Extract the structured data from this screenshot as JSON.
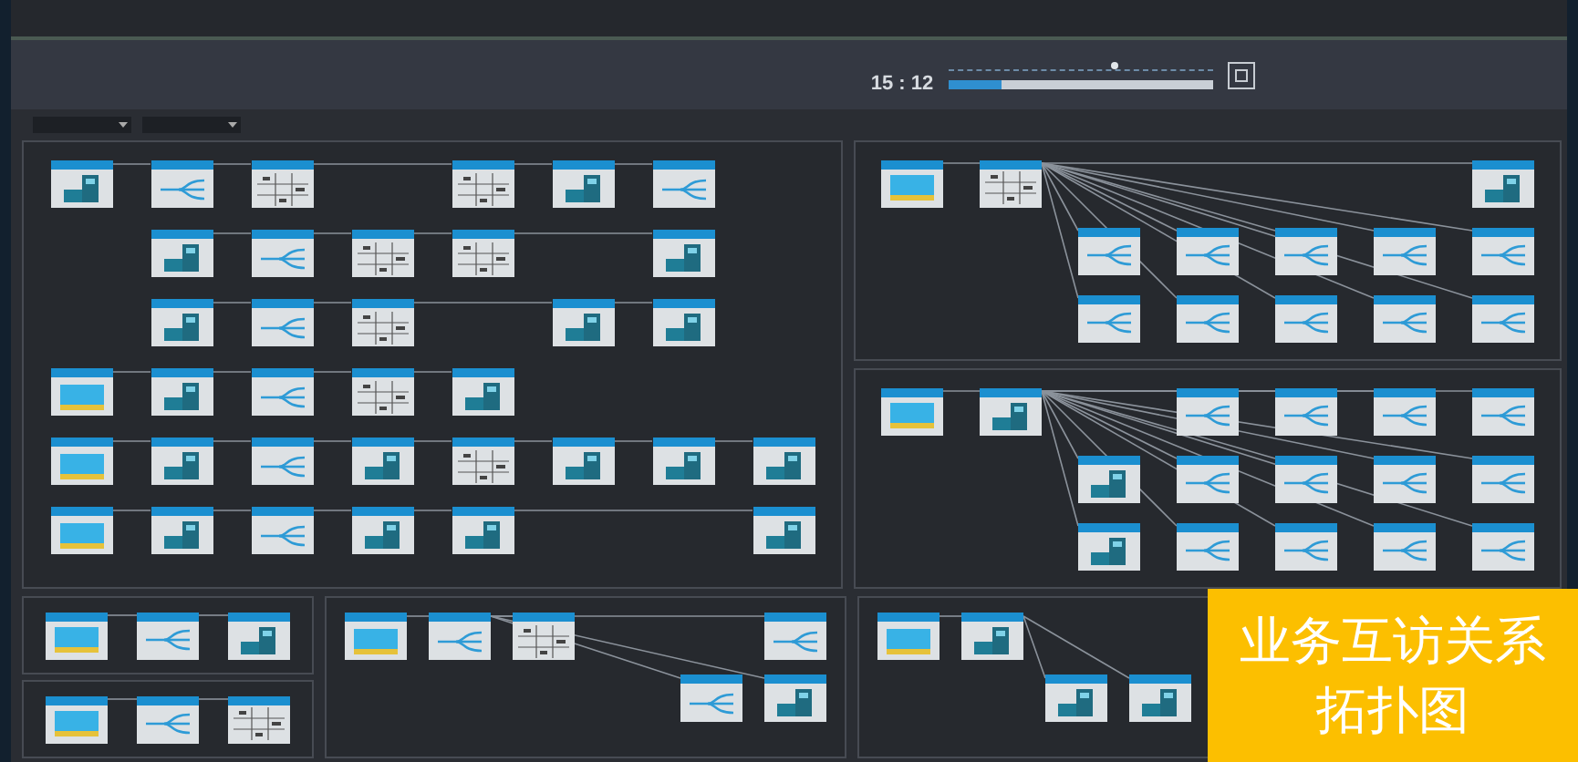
{
  "timeline": {
    "time": "15 : 12",
    "slider": {
      "level": 0.63
    },
    "progress": {
      "level": 0.2
    }
  },
  "filters": [
    {
      "kind": "dropdown"
    },
    {
      "kind": "dropdown"
    }
  ],
  "main_panels": [
    {
      "kind": "rows",
      "rows": [
        {
          "cells": [
            {
              "kind": "server"
            },
            {
              "kind": "switch"
            },
            {
              "kind": "table"
            },
            {
              "kind": "gap"
            },
            {
              "kind": "table"
            },
            {
              "kind": "server"
            },
            {
              "kind": "switch"
            },
            {
              "kind": "gap"
            }
          ]
        },
        {
          "cells": [
            {
              "kind": "gap"
            },
            {
              "kind": "server"
            },
            {
              "kind": "switch"
            },
            {
              "kind": "table"
            },
            {
              "kind": "table"
            },
            {
              "kind": "gap"
            },
            {
              "kind": "server"
            },
            {
              "kind": "gap"
            }
          ]
        },
        {
          "cells": [
            {
              "kind": "gap"
            },
            {
              "kind": "server"
            },
            {
              "kind": "switch"
            },
            {
              "kind": "table"
            },
            {
              "kind": "gap"
            },
            {
              "kind": "server"
            },
            {
              "kind": "server"
            },
            {
              "kind": "gap"
            }
          ]
        },
        {
          "cells": [
            {
              "kind": "client"
            },
            {
              "kind": "server"
            },
            {
              "kind": "switch"
            },
            {
              "kind": "table"
            },
            {
              "kind": "server"
            },
            {
              "kind": "gap"
            },
            {
              "kind": "gap"
            },
            {
              "kind": "gap"
            }
          ]
        },
        {
          "cells": [
            {
              "kind": "client"
            },
            {
              "kind": "server"
            },
            {
              "kind": "switch"
            },
            {
              "kind": "server"
            },
            {
              "kind": "table"
            },
            {
              "kind": "server"
            },
            {
              "kind": "server"
            },
            {
              "kind": "server"
            }
          ]
        },
        {
          "cells": [
            {
              "kind": "client"
            },
            {
              "kind": "server"
            },
            {
              "kind": "switch"
            },
            {
              "kind": "server"
            },
            {
              "kind": "server"
            },
            {
              "kind": "gap"
            },
            {
              "kind": "gap"
            },
            {
              "kind": "server"
            }
          ]
        }
      ]
    }
  ],
  "side_panels": [
    {
      "kind": "fan",
      "rows": [
        {
          "cells": [
            {
              "kind": "client"
            },
            {
              "kind": "table"
            },
            {
              "kind": "gap"
            },
            {
              "kind": "gap"
            },
            {
              "kind": "gap"
            },
            {
              "kind": "gap"
            },
            {
              "kind": "server"
            }
          ]
        },
        {
          "cells": [
            {
              "kind": "gap"
            },
            {
              "kind": "gap"
            },
            {
              "kind": "switch"
            },
            {
              "kind": "switch"
            },
            {
              "kind": "switch"
            },
            {
              "kind": "switch"
            },
            {
              "kind": "switch"
            }
          ]
        },
        {
          "cells": [
            {
              "kind": "gap"
            },
            {
              "kind": "gap"
            },
            {
              "kind": "switch"
            },
            {
              "kind": "switch"
            },
            {
              "kind": "switch"
            },
            {
              "kind": "switch"
            },
            {
              "kind": "switch"
            }
          ]
        }
      ]
    },
    {
      "kind": "fan",
      "rows": [
        {
          "cells": [
            {
              "kind": "client"
            },
            {
              "kind": "server"
            },
            {
              "kind": "gap"
            },
            {
              "kind": "switch"
            },
            {
              "kind": "switch"
            },
            {
              "kind": "switch"
            },
            {
              "kind": "switch"
            }
          ]
        },
        {
          "cells": [
            {
              "kind": "gap"
            },
            {
              "kind": "gap"
            },
            {
              "kind": "server"
            },
            {
              "kind": "switch"
            },
            {
              "kind": "switch"
            },
            {
              "kind": "switch"
            },
            {
              "kind": "switch"
            }
          ]
        },
        {
          "cells": [
            {
              "kind": "gap"
            },
            {
              "kind": "gap"
            },
            {
              "kind": "server"
            },
            {
              "kind": "switch"
            },
            {
              "kind": "switch"
            },
            {
              "kind": "switch"
            },
            {
              "kind": "switch"
            }
          ]
        }
      ]
    }
  ],
  "bottom_panels": [
    {
      "kind": "rows",
      "rows": [
        {
          "cells": [
            {
              "kind": "client"
            },
            {
              "kind": "switch"
            },
            {
              "kind": "server"
            }
          ]
        }
      ]
    },
    {
      "kind": "rows",
      "rows": [
        {
          "cells": [
            {
              "kind": "client"
            },
            {
              "kind": "switch"
            },
            {
              "kind": "table"
            }
          ]
        }
      ]
    },
    {
      "kind": "fan",
      "rows": [
        {
          "cells": [
            {
              "kind": "client"
            },
            {
              "kind": "switch"
            },
            {
              "kind": "table"
            },
            {
              "kind": "gap"
            },
            {
              "kind": "gap"
            },
            {
              "kind": "switch"
            }
          ]
        },
        {
          "cells": [
            {
              "kind": "gap"
            },
            {
              "kind": "gap"
            },
            {
              "kind": "gap"
            },
            {
              "kind": "gap"
            },
            {
              "kind": "switch"
            },
            {
              "kind": "server"
            }
          ]
        }
      ]
    },
    {
      "kind": "fan",
      "rows": [
        {
          "cells": [
            {
              "kind": "client"
            },
            {
              "kind": "server"
            },
            {
              "kind": "gap"
            },
            {
              "kind": "gap"
            },
            {
              "kind": "gap"
            },
            {
              "kind": "gap"
            }
          ]
        },
        {
          "cells": [
            {
              "kind": "gap"
            },
            {
              "kind": "gap"
            },
            {
              "kind": "server"
            },
            {
              "kind": "server"
            },
            {
              "kind": "gap"
            },
            {
              "kind": "gap"
            }
          ]
        }
      ]
    }
  ],
  "caption": {
    "text": "业务互访关系拓扑图"
  }
}
